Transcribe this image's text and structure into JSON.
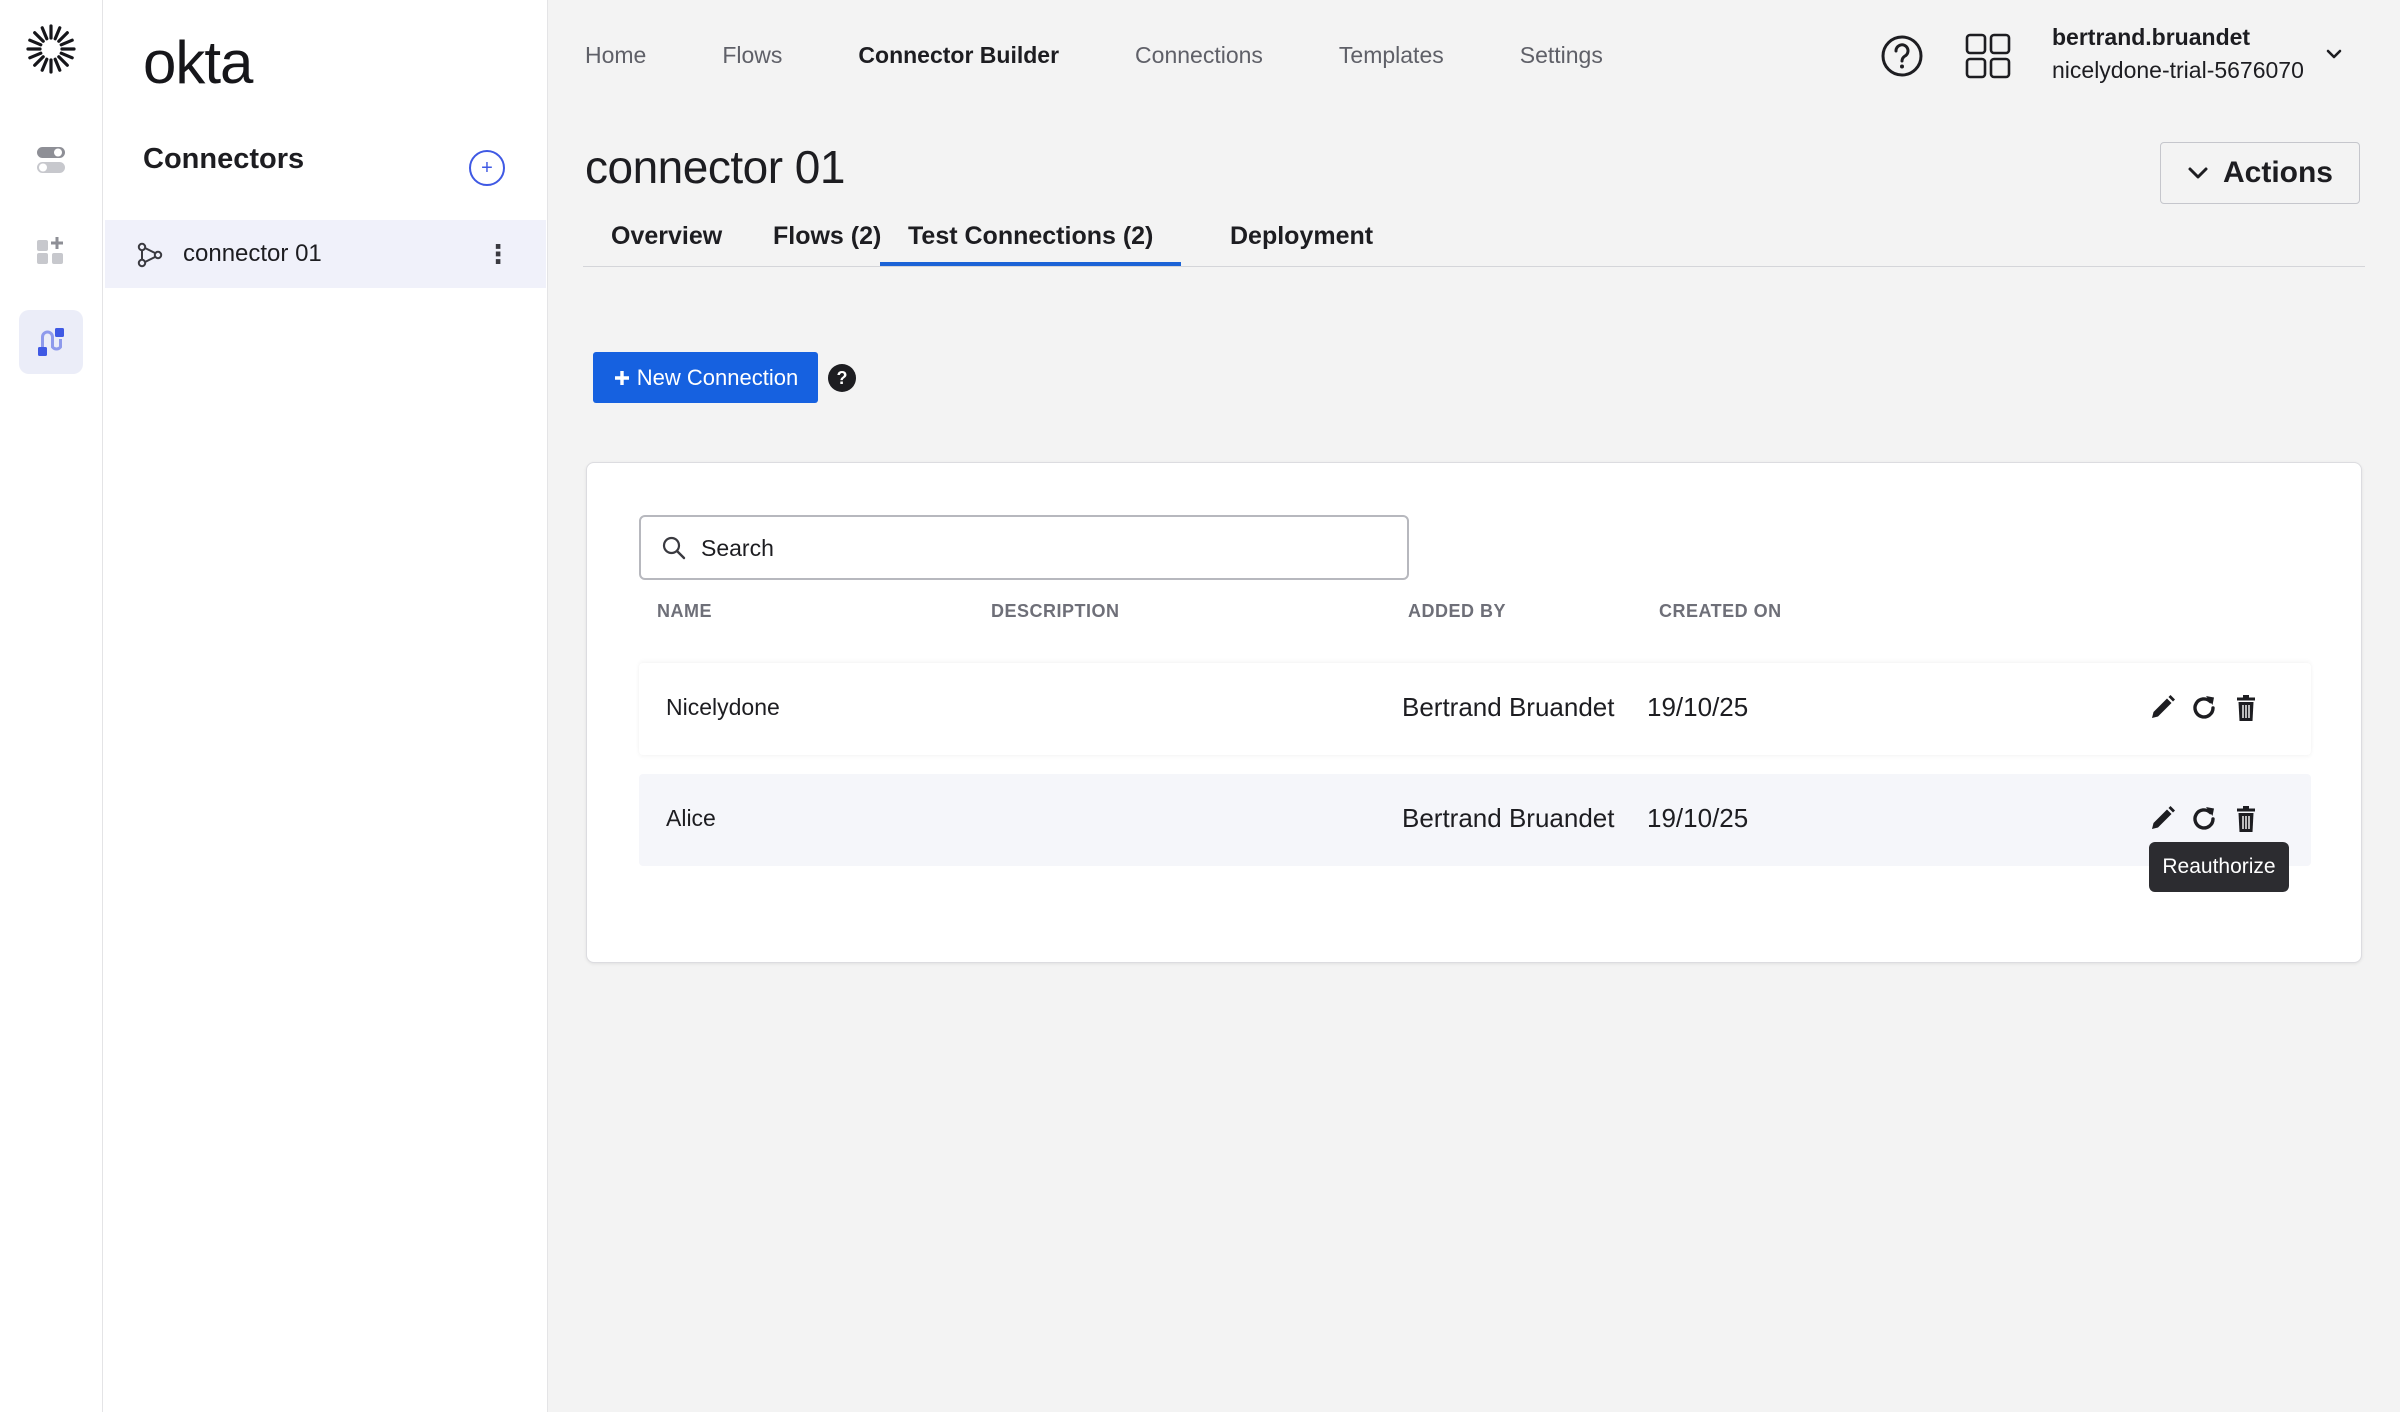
{
  "brand": {
    "name": "okta",
    "accent": "#1661e0"
  },
  "rail": {
    "items": [
      "toggle-icon",
      "add-apps-icon",
      "connector-builder-icon"
    ]
  },
  "sidebar": {
    "title": "Connectors",
    "add_label": "+",
    "items": [
      {
        "label": "connector 01"
      }
    ]
  },
  "topnav": {
    "items": [
      "Home",
      "Flows",
      "Connector Builder",
      "Connections",
      "Templates",
      "Settings"
    ],
    "active": "Connector Builder"
  },
  "user": {
    "name": "bertrand.bruandet",
    "org": "nicelydone-trial-5676070"
  },
  "page": {
    "title": "connector 01",
    "actions_label": "Actions",
    "tabs": [
      "Overview",
      "Flows (2)",
      "Test Connections (2)",
      "Deployment"
    ],
    "active_tab": "Test Connections (2)"
  },
  "toolbar": {
    "new_connection_label": "New Connection",
    "help_label": "?"
  },
  "table": {
    "search_placeholder": "Search",
    "columns": [
      "NAME",
      "DESCRIPTION",
      "ADDED BY",
      "CREATED ON"
    ],
    "rows": [
      {
        "name": "Nicelydone",
        "description": "",
        "added_by": "Bertrand Bruandet",
        "created_on": "19/10/25"
      },
      {
        "name": "Alice",
        "description": "",
        "added_by": "Bertrand Bruandet",
        "created_on": "19/10/25"
      }
    ]
  },
  "tooltip": {
    "text": "Reauthorize"
  }
}
